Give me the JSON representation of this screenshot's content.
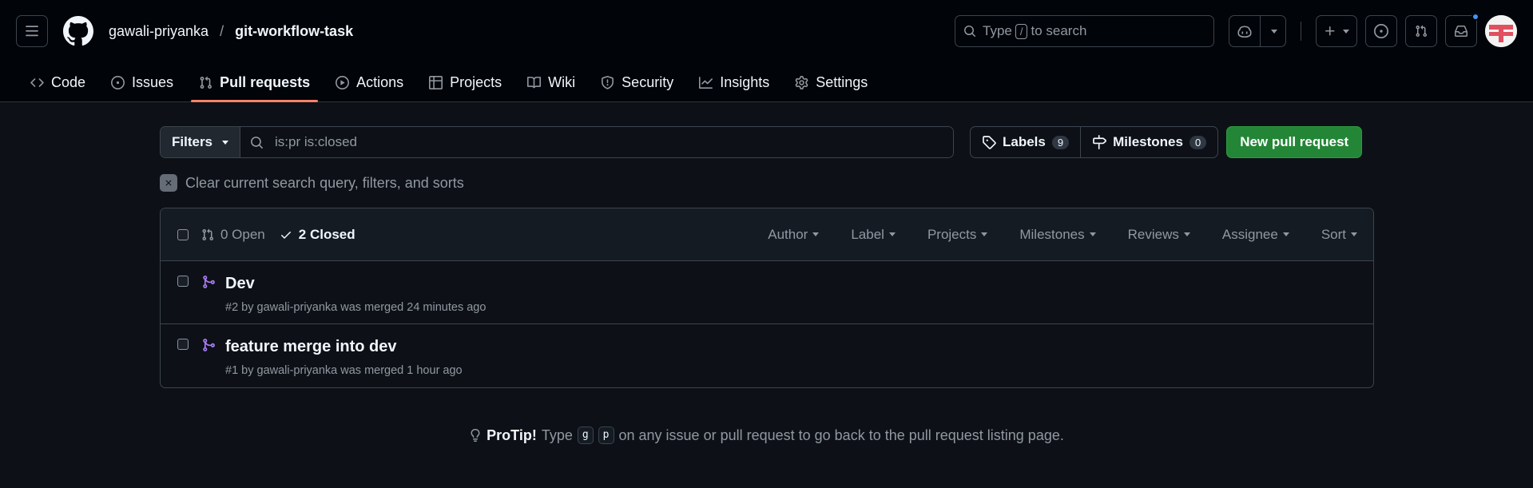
{
  "header": {
    "owner": "gawali-priyanka",
    "separator": "/",
    "repo": "git-workflow-task",
    "search_prefix": "Type",
    "search_key": "/",
    "search_suffix": "to search"
  },
  "tabs": [
    {
      "label": "Code",
      "icon": "code-icon"
    },
    {
      "label": "Issues",
      "icon": "issue-opened-icon"
    },
    {
      "label": "Pull requests",
      "icon": "git-pull-request-icon",
      "active": true
    },
    {
      "label": "Actions",
      "icon": "play-icon"
    },
    {
      "label": "Projects",
      "icon": "table-icon"
    },
    {
      "label": "Wiki",
      "icon": "book-icon"
    },
    {
      "label": "Security",
      "icon": "shield-icon"
    },
    {
      "label": "Insights",
      "icon": "graph-icon"
    },
    {
      "label": "Settings",
      "icon": "gear-icon"
    }
  ],
  "filterbar": {
    "filters_label": "Filters",
    "query": "is:pr is:closed",
    "labels_label": "Labels",
    "labels_count": "9",
    "milestones_label": "Milestones",
    "milestones_count": "0",
    "new_pr_label": "New pull request"
  },
  "clear_text": "Clear current search query, filters, and sorts",
  "list_header": {
    "open_label": "0 Open",
    "closed_label": "2 Closed",
    "dropdowns": [
      "Author",
      "Label",
      "Projects",
      "Milestones",
      "Reviews",
      "Assignee",
      "Sort"
    ]
  },
  "pull_requests": [
    {
      "title": "Dev",
      "meta": "#2 by gawali-priyanka was merged 24 minutes ago"
    },
    {
      "title": "feature merge into dev",
      "meta": "#1 by gawali-priyanka was merged 1 hour ago"
    }
  ],
  "protip": {
    "label": "ProTip!",
    "pre": "Type",
    "key1": "g",
    "key2": "p",
    "post": "on any issue or pull request to go back to the pull request listing page."
  },
  "colors": {
    "background": "#0d1117",
    "header_bg": "#010409",
    "accent_underline": "#f78166",
    "primary_button": "#238636",
    "merged_purple": "#ab7df8",
    "notification_dot": "#4493f8"
  }
}
